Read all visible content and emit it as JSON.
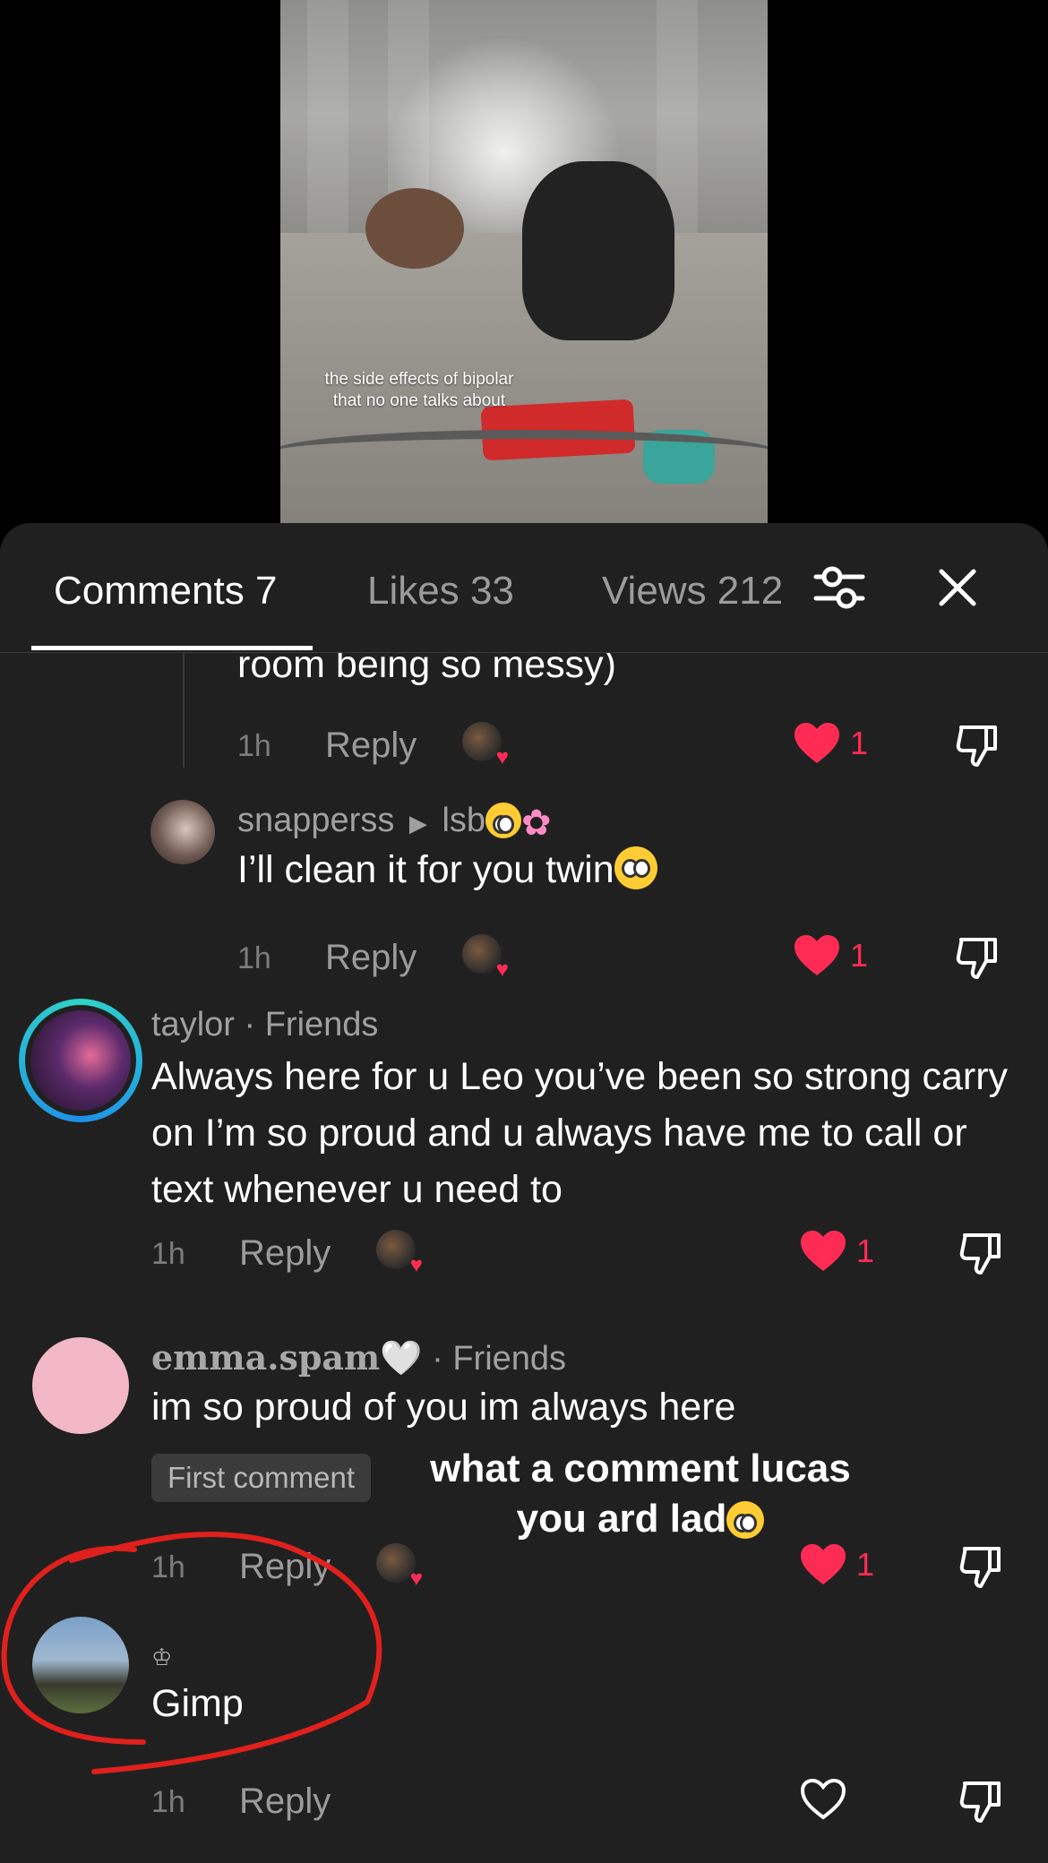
{
  "video": {
    "caption_line1": "the side effects of bipolar",
    "caption_line2": "that no one talks about"
  },
  "tabs": [
    {
      "label": "Comments 7",
      "active": true
    },
    {
      "label": "Likes 33",
      "active": false
    },
    {
      "label": "Views 212",
      "active": false
    }
  ],
  "icons": {
    "filter": "sliders-icon",
    "close": "close-icon",
    "like": "heart-icon",
    "dislike": "thumbs-down-icon"
  },
  "colors": {
    "accent": "#fe2c55",
    "sheet": "#202020",
    "annotation": "#e0201c"
  },
  "comments": [
    {
      "body": "room being so messy)",
      "time": "1h",
      "reply": "Reply",
      "likes": "1"
    },
    {
      "username": "snapperss",
      "reply_to": "lsb",
      "body": "I’ll clean it for you twin",
      "time": "1h",
      "reply": "Reply",
      "likes": "1"
    },
    {
      "username": "taylor",
      "tag": "· Friends",
      "body": "Always here for u Leo you’ve been so strong carry on I’m so proud and u always have me to call or text whenever u need to",
      "time": "1h",
      "reply": "Reply",
      "likes": "1"
    },
    {
      "username": "emma.spam🤍",
      "tag": "· Friends",
      "body": "im so proud of you im always here",
      "chip": "First comment",
      "time": "1h",
      "reply": "Reply",
      "likes": "1"
    },
    {
      "badge": "♔",
      "body": "Gimp",
      "time": "1h",
      "reply": "Reply"
    }
  ],
  "overlay": {
    "line1": "what a comment lucas",
    "line2": "you ard lad"
  }
}
